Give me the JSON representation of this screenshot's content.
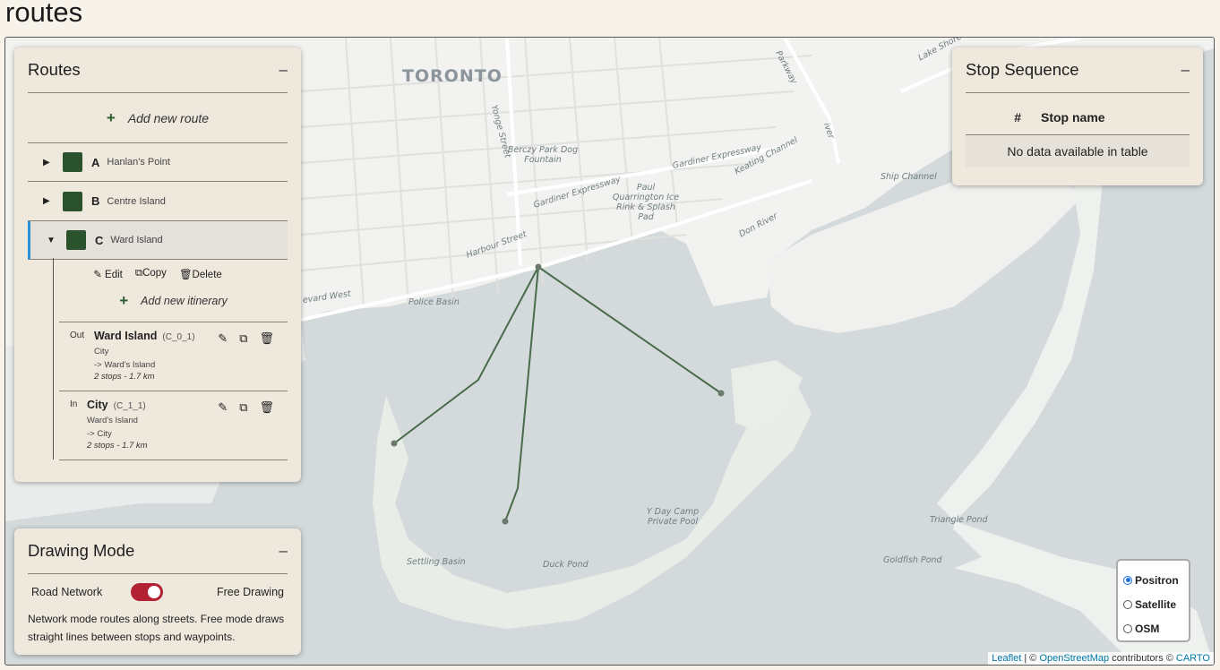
{
  "page": {
    "title": "routes"
  },
  "map": {
    "labels": {
      "city": "TORONTO",
      "yonge_street": "Yonge Street",
      "berczy_park": "Berczy Park Dog Fountain",
      "paul_quarrington": "Paul Quarrington Ice Rink & Splash Pad",
      "gardiner_1": "Gardiner Expressway",
      "gardiner_2": "Gardiner Expressway",
      "keating": "Keating Channel",
      "don_river": "Don River",
      "ship_channel": "Ship Channel",
      "harbour_street": "Harbour Street",
      "police_basin": "Police Basin",
      "boulevard_west": "evard West",
      "lake_shore": "Lake Shore",
      "parkway": "Parkway",
      "river": "iver",
      "y_day_camp": "Y Day Camp Private Pool",
      "settling_basin": "Settling Basin",
      "duck_pond": "Duck Pond",
      "triangle_pond": "Triangle Pond",
      "goldfish_pond": "Goldfish Pond"
    },
    "route_color": "#4a6b4c",
    "water_color": "#d4dadc",
    "land_color": "#f2f2f0"
  },
  "routes_panel": {
    "title": "Routes",
    "collapse": "–",
    "add_route": "Add new route",
    "routes": [
      {
        "letter": "A",
        "name": "Hanlan's Point",
        "expanded": false,
        "color": "#2a532d"
      },
      {
        "letter": "B",
        "name": "Centre Island",
        "expanded": false,
        "color": "#2a532d"
      },
      {
        "letter": "C",
        "name": "Ward Island",
        "expanded": true,
        "color": "#2a532d"
      }
    ],
    "actions": {
      "edit": "Edit",
      "copy": "Copy",
      "delete": "Delete"
    },
    "add_itinerary": "Add new itinerary",
    "itineraries": [
      {
        "dir": "Out",
        "title": "Ward Island",
        "code": "(C_0_1)",
        "from": "City",
        "to": "-> Ward's Island",
        "stats": "2 stops - 1.7 km"
      },
      {
        "dir": "In",
        "title": "City",
        "code": "(C_1_1)",
        "from": "Ward's Island",
        "to": "-> City",
        "stats": "2 stops - 1.7 km"
      }
    ]
  },
  "stop_panel": {
    "title": "Stop Sequence",
    "collapse": "–",
    "col_num": "#",
    "col_name": "Stop name",
    "empty": "No data available in table"
  },
  "drawing_panel": {
    "title": "Drawing Mode",
    "collapse": "–",
    "left": "Road Network",
    "right": "Free Drawing",
    "desc": "Network mode routes along streets. Free mode draws straight lines between stops and waypoints.",
    "toggle_on": true
  },
  "layers": {
    "options": [
      "Positron",
      "Satellite",
      "OSM"
    ],
    "selected": "Positron"
  },
  "attribution": {
    "leaflet": "Leaflet",
    "sep": "| ©",
    "osm": "OpenStreetMap",
    "mid": "contributors ©",
    "carto": "CARTO"
  }
}
